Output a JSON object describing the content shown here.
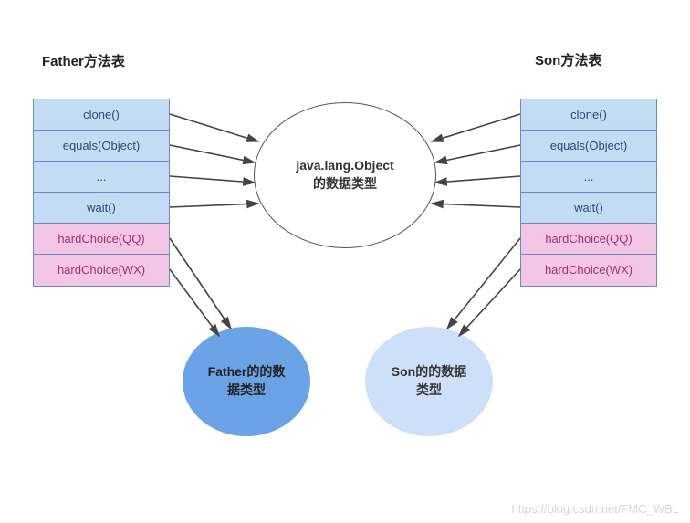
{
  "titles": {
    "left": "Father方法表",
    "right": "Son方法表"
  },
  "leftTable": {
    "rows": [
      {
        "text": "clone()",
        "cls": "blue"
      },
      {
        "text": "equals(Object)",
        "cls": "blue"
      },
      {
        "text": "...",
        "cls": "blue"
      },
      {
        "text": "wait()",
        "cls": "blue"
      },
      {
        "text": "hardChoice(QQ)",
        "cls": "pink"
      },
      {
        "text": "hardChoice(WX)",
        "cls": "pink"
      }
    ]
  },
  "rightTable": {
    "rows": [
      {
        "text": "clone()",
        "cls": "blue"
      },
      {
        "text": "equals(Object)",
        "cls": "blue"
      },
      {
        "text": "...",
        "cls": "blue"
      },
      {
        "text": "wait()",
        "cls": "blue"
      },
      {
        "text": "hardChoice(QQ)",
        "cls": "pink"
      },
      {
        "text": "hardChoice(WX)",
        "cls": "pink"
      }
    ]
  },
  "ellipses": {
    "center": "java.lang.Object\n的数据类型",
    "father": "Father的的数\n据类型",
    "son": "Son的的数据\n类型"
  },
  "watermark": "https://blog.csdn.net/FMC_WBL"
}
